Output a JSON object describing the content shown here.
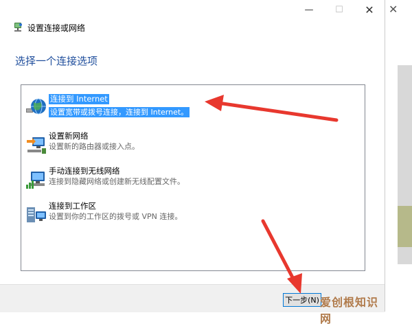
{
  "window": {
    "controls": {
      "minimize": "—",
      "maximize": "☐",
      "close": "✕"
    },
    "title": "设置连接或网络"
  },
  "heading": "选择一个连接选项",
  "options": [
    {
      "title": "连接到 Internet",
      "desc": "设置宽带或拨号连接，连接到 Internet。",
      "icon": "globe-network-icon",
      "selected": true
    },
    {
      "title": "设置新网络",
      "desc": "设置新的路由器或接入点。",
      "icon": "new-network-icon",
      "selected": false
    },
    {
      "title": "手动连接到无线网络",
      "desc": "连接到隐藏网络或创建新无线配置文件。",
      "icon": "wireless-network-icon",
      "selected": false
    },
    {
      "title": "连接到工作区",
      "desc": "设置到你的工作区的拨号或 VPN 连接。",
      "icon": "workplace-network-icon",
      "selected": false
    }
  ],
  "footer": {
    "next_button": "下一步(N)"
  },
  "watermark": "爱创根知识网",
  "right_strip": {
    "close": "✕"
  },
  "colors": {
    "heading": "#1f4e9c",
    "selection": "#3399ff",
    "arrow": "#e8382e"
  }
}
